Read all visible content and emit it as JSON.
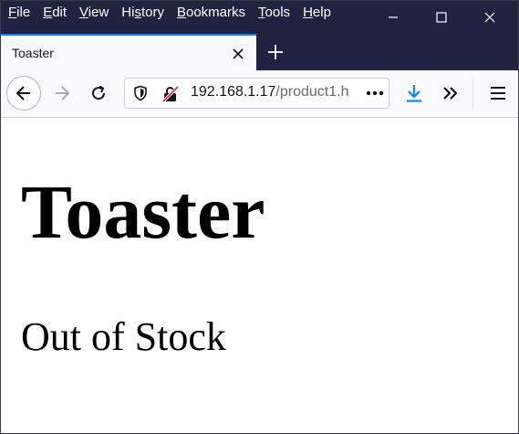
{
  "menubar": {
    "items": [
      {
        "label_pre": "",
        "label_ul": "F",
        "label_post": "ile"
      },
      {
        "label_pre": "",
        "label_ul": "E",
        "label_post": "dit"
      },
      {
        "label_pre": "",
        "label_ul": "V",
        "label_post": "iew"
      },
      {
        "label_pre": "Hi",
        "label_ul": "s",
        "label_post": "tory"
      },
      {
        "label_pre": "",
        "label_ul": "B",
        "label_post": "ookmarks"
      },
      {
        "label_pre": "",
        "label_ul": "T",
        "label_post": "ools"
      },
      {
        "label_pre": "",
        "label_ul": "H",
        "label_post": "elp"
      }
    ]
  },
  "tab": {
    "title": "Toaster"
  },
  "urlbar": {
    "host": "192.168.1.17",
    "path": "/product1.h"
  },
  "page": {
    "heading": "Toaster",
    "status": "Out of Stock"
  },
  "colors": {
    "titlebar": "#202340",
    "tab_accent": "#0a84ff",
    "download_icon": "#0a84ff"
  }
}
